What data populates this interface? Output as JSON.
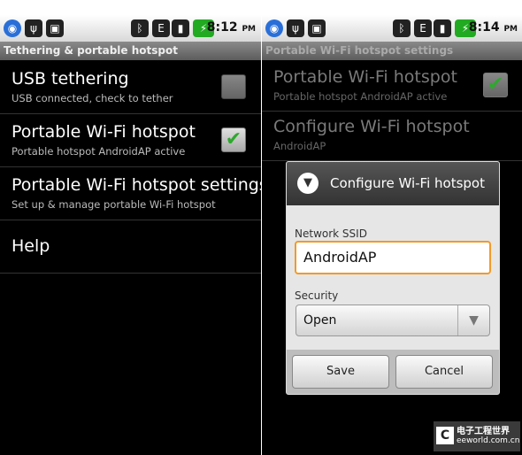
{
  "left": {
    "status_time": "8:12",
    "status_ampm": "PM",
    "title": "Tethering & portable hotspot",
    "items": [
      {
        "title": "USB tethering",
        "subtitle": "USB connected, check to tether",
        "checked": false
      },
      {
        "title": "Portable Wi-Fi hotspot",
        "subtitle": "Portable hotspot AndroidAP active",
        "checked": true
      },
      {
        "title": "Portable Wi-Fi hotspot settings",
        "subtitle": "Set up & manage portable Wi-Fi hotspot"
      },
      {
        "title": "Help"
      }
    ]
  },
  "right": {
    "status_time": "8:14",
    "status_ampm": "PM",
    "title": "Portable Wi-Fi hotspot settings",
    "items": [
      {
        "title": "Portable Wi-Fi hotspot",
        "subtitle": "Portable hotspot AndroidAP active",
        "checked": true
      },
      {
        "title": "Configure Wi-Fi hotspot",
        "subtitle": "AndroidAP"
      }
    ],
    "dialog": {
      "title": "Configure Wi-Fi hotspot",
      "ssid_label": "Network SSID",
      "ssid_value": "AndroidAP",
      "security_label": "Security",
      "security_value": "Open",
      "save": "Save",
      "cancel": "Cancel"
    }
  },
  "status_icons": [
    "wifi-icon",
    "usb-icon",
    "android-icon",
    "bluetooth-icon",
    "edge-data-icon",
    "signal-icon",
    "battery-icon"
  ],
  "watermark": {
    "cn": "电子工程世界",
    "site": "eeworld.com.cn"
  },
  "colors": {
    "check": "#2ea82e",
    "focus": "#f19a2a"
  }
}
